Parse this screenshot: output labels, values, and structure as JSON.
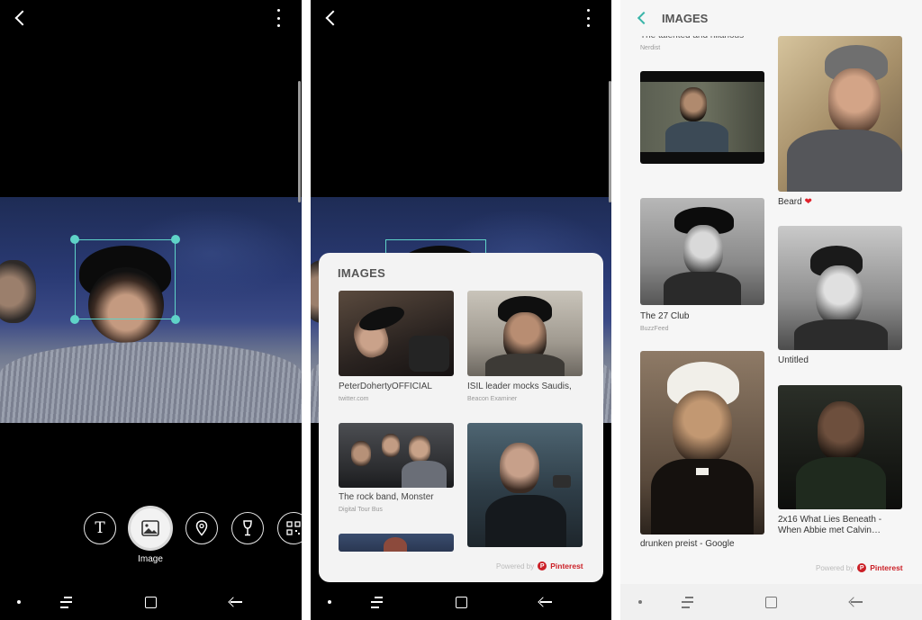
{
  "panel1": {
    "mode_label": "Image",
    "icons": [
      "back-icon",
      "more-vertical-icon",
      "text-icon",
      "image-icon",
      "location-icon",
      "wine-icon",
      "qr-code-icon"
    ]
  },
  "panel2": {
    "card_title": "IMAGES",
    "results": [
      {
        "caption": "PeterDohertyOFFICIAL",
        "source": "twitter.com"
      },
      {
        "caption": "ISIL leader mocks Saudis,",
        "source": "Beacon Examiner"
      },
      {
        "caption": "The rock band, Monster",
        "source": "Digital Tour Bus"
      },
      {
        "caption": "",
        "source": ""
      }
    ],
    "powered_by": "Powered by",
    "powered_brand": "Pinterest"
  },
  "panel3": {
    "title": "IMAGES",
    "partial_caption": "The talented and hilarious",
    "partial_source": "Nerdist",
    "left_results": [
      {
        "caption": "",
        "source": ""
      },
      {
        "caption": "The 27 Club",
        "source": "BuzzFeed"
      },
      {
        "caption": "drunken preist - Google",
        "source": ""
      }
    ],
    "right_results": [
      {
        "caption": "Beard",
        "source": ""
      },
      {
        "caption": "Untitled",
        "source": ""
      },
      {
        "caption_line1": "2x16 What Lies Beneath -",
        "caption_line2": "When Abbie met Calvin…",
        "source": ""
      }
    ],
    "powered_by": "Powered by",
    "powered_brand": "Pinterest"
  },
  "colors": {
    "accent": "#5fd3c8",
    "pinterest": "#cb2027",
    "heart": "#e0212b"
  }
}
